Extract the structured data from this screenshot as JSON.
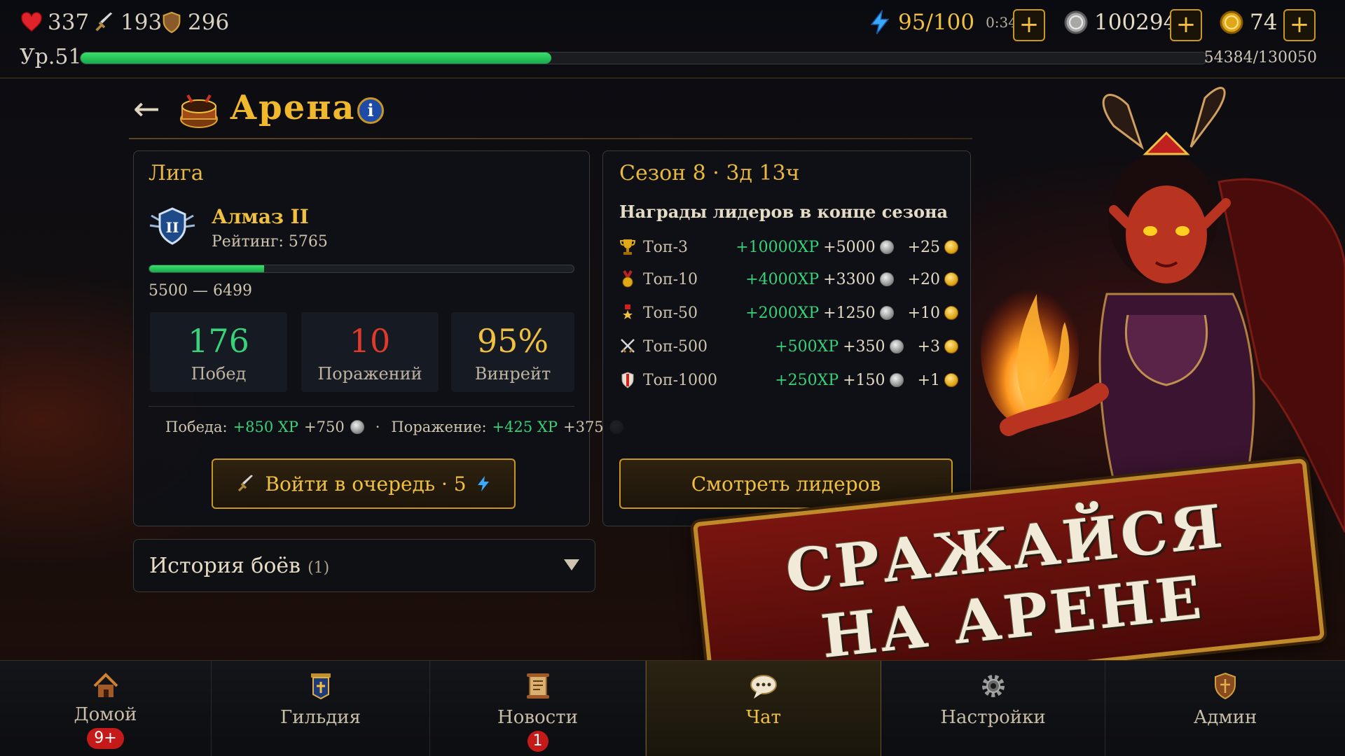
{
  "top": {
    "health": "337",
    "attack": "193",
    "defense": "296",
    "level": "Ур.51",
    "xp_text": "54384/130050",
    "xp_fraction": 0.418,
    "energy": "95/100",
    "energy_timer": "0:34",
    "silver": "100294",
    "gold": "74",
    "plus": "+"
  },
  "header": {
    "back": "←",
    "title": "Арена",
    "info": "i"
  },
  "league": {
    "title": "Лига",
    "rank": "Алмаз II",
    "rating": "Рейтинг: 5765",
    "range": "5500  —  6499",
    "progress_fraction": 0.27,
    "wins": "176",
    "wins_label": "Побед",
    "losses": "10",
    "losses_label": "Поражений",
    "winrate": "95%",
    "winrate_label": "Винрейт",
    "win_label": "Победа:",
    "win_xp": "+850 XP",
    "win_silver": "+750",
    "dot": "·",
    "loss_label": "Поражение:",
    "loss_xp": "+425 XP",
    "loss_silver": "+375",
    "queue_button": "Войти в очередь · 5"
  },
  "season": {
    "title": "Сезон 8 · 3д 13ч",
    "subtitle": "Награды лидеров в конце сезона",
    "rows": [
      {
        "name": "Топ-3",
        "xp": "+10000XP",
        "silver": "+5000",
        "gold": "+25",
        "icon": "trophy-icon"
      },
      {
        "name": "Топ-10",
        "xp": "+4000XP",
        "silver": "+3300",
        "gold": "+20",
        "icon": "medal-icon"
      },
      {
        "name": "Топ-50",
        "xp": "+2000XP",
        "silver": "+1250",
        "gold": "+10",
        "icon": "star-medal-icon"
      },
      {
        "name": "Топ-500",
        "xp": "+500XP",
        "silver": "+350",
        "gold": "+3",
        "icon": "crossed-swords-icon"
      },
      {
        "name": "Топ-1000",
        "xp": "+250XP",
        "silver": "+150",
        "gold": "+1",
        "icon": "shield-icon"
      }
    ],
    "leaders_button": "Смотреть лидеров"
  },
  "history": {
    "title": "История боёв",
    "count": "(1)"
  },
  "promo": {
    "line1": "СРАЖАЙСЯ",
    "line2": "НА АРЕНЕ"
  },
  "nav": {
    "home": "Домой",
    "home_badge": "9+",
    "guild": "Гильдия",
    "news": "Новости",
    "news_badge": "1",
    "chat": "Чат",
    "settings": "Настройки",
    "admin": "Админ"
  },
  "colors": {
    "accent": "#f0c040",
    "green": "#37d27a",
    "red": "#e03a2a",
    "panel": "#0e1016"
  }
}
